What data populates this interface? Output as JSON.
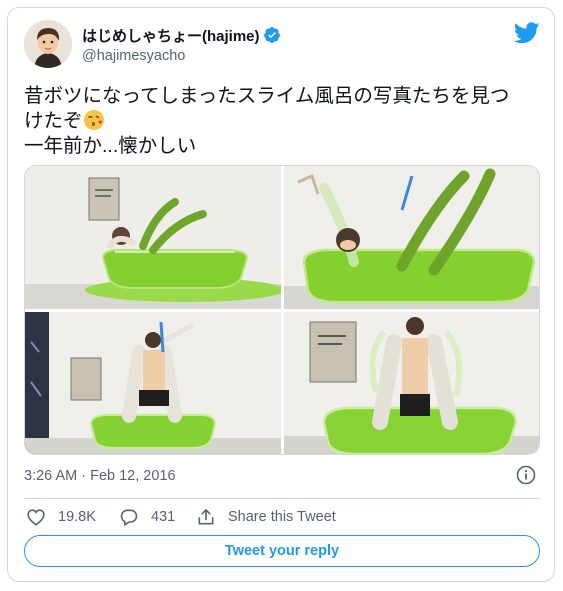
{
  "user": {
    "display_name": "はじめしゃちょー(hajime)",
    "handle": "@hajimesyacho",
    "verified": true,
    "avatar": "avatar-photo"
  },
  "icons": {
    "brand": "twitter-bird-icon",
    "verified": "verified-badge-icon",
    "emoji": "face-blowing-kiss-emoji",
    "info": "info-icon",
    "like": "heart-icon",
    "reply": "reply-bubble-icon",
    "share": "share-icon"
  },
  "tweet": {
    "line1": "昔ボツになってしまったスライム風呂の写真たちを見つ",
    "line2": "けたぞ",
    "line3": "一年前か...懐かしい",
    "media": [
      {
        "alt": "slime-bath-photo-1"
      },
      {
        "alt": "slime-bath-photo-2"
      },
      {
        "alt": "slime-bath-photo-3"
      },
      {
        "alt": "slime-bath-photo-4"
      }
    ]
  },
  "meta": {
    "timestamp": "3:26 AM · Feb 12, 2016"
  },
  "actions": {
    "likes": "19.8K",
    "replies": "431",
    "share_label": "Share this Tweet"
  },
  "reply_button": {
    "label": "Tweet your reply"
  },
  "colors": {
    "brand": "#1d9bf0",
    "text": "#0f1419",
    "secondary": "#536471",
    "border": "#cfd9de",
    "slime": "#7ccc2a"
  }
}
